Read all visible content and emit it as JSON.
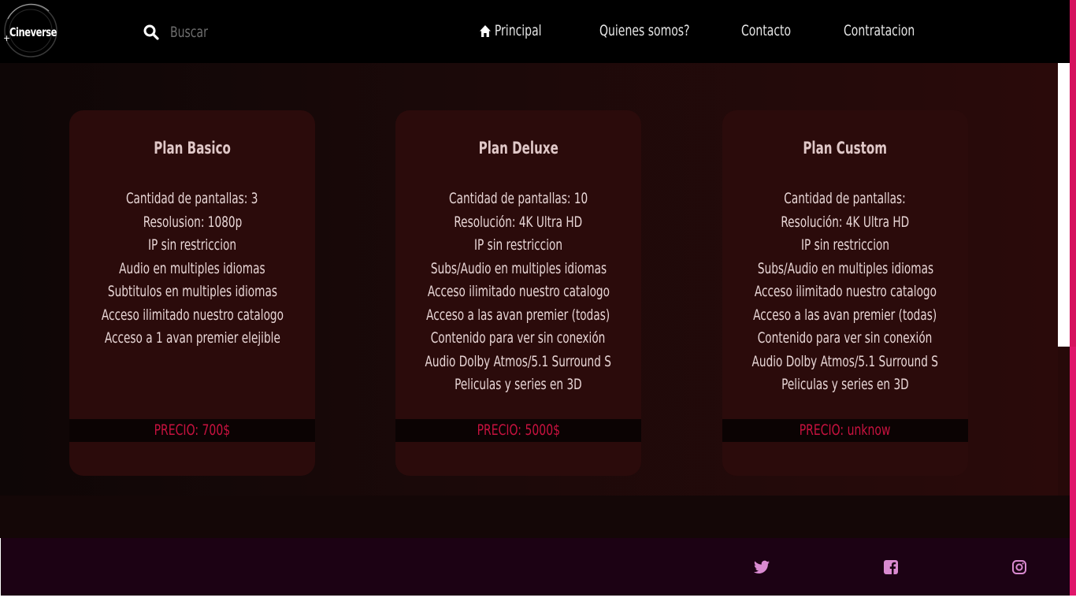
{
  "brand": {
    "logo_text": "Cineverse",
    "logo_plus": "+"
  },
  "search": {
    "placeholder": "Buscar",
    "icon": "search-icon"
  },
  "nav": {
    "items": [
      {
        "label": "Principal",
        "icon": "home-icon"
      },
      {
        "label": "Quienes somos?"
      },
      {
        "label": "Contacto"
      },
      {
        "label": "Contratacion"
      }
    ]
  },
  "plans": [
    {
      "title": "Plan Basico",
      "features": [
        "Cantidad de pantallas: 3",
        "Resolusion: 1080p",
        "IP sin restriccion",
        "Audio en multiples idiomas",
        "Subtitulos en multiples idiomas",
        "Acceso ilimitado nuestro catalogo",
        "Acceso a 1 avan premier elejible"
      ],
      "price": "PRECIO: 700$"
    },
    {
      "title": "Plan Deluxe",
      "features": [
        "Cantidad de pantallas: 10",
        "Resolución: 4K Ultra HD",
        "IP sin restriccion",
        "Subs/Audio en multiples idiomas",
        "Acceso ilimitado nuestro catalogo",
        "Acceso a las avan premier (todas)",
        "Contenido para ver sin conexión",
        "Audio Dolby Atmos/5.1 Surround S",
        "Peliculas y series en 3D"
      ],
      "price": "PRECIO: 5000$"
    },
    {
      "title": "Plan Custom",
      "features": [
        "Cantidad de pantallas:",
        "Resolución: 4K Ultra HD",
        "IP sin restriccion",
        "Subs/Audio en multiples idiomas",
        "Acceso ilimitado nuestro catalogo",
        "Acceso a las avan premier (todas)",
        "Contenido para ver sin conexión",
        "Audio Dolby Atmos/5.1 Surround S",
        "Peliculas y series en 3D"
      ],
      "price": "PRECIO: unknow"
    }
  ],
  "footer": {
    "social": [
      "twitter-icon",
      "facebook-icon",
      "instagram-icon"
    ]
  },
  "colors": {
    "accent_pink": "#d6125e",
    "price_red": "#c8123f",
    "card_bg": "#2b0b0b",
    "footer_bg": "#1c0214",
    "social_icon": "#d98ad0"
  }
}
